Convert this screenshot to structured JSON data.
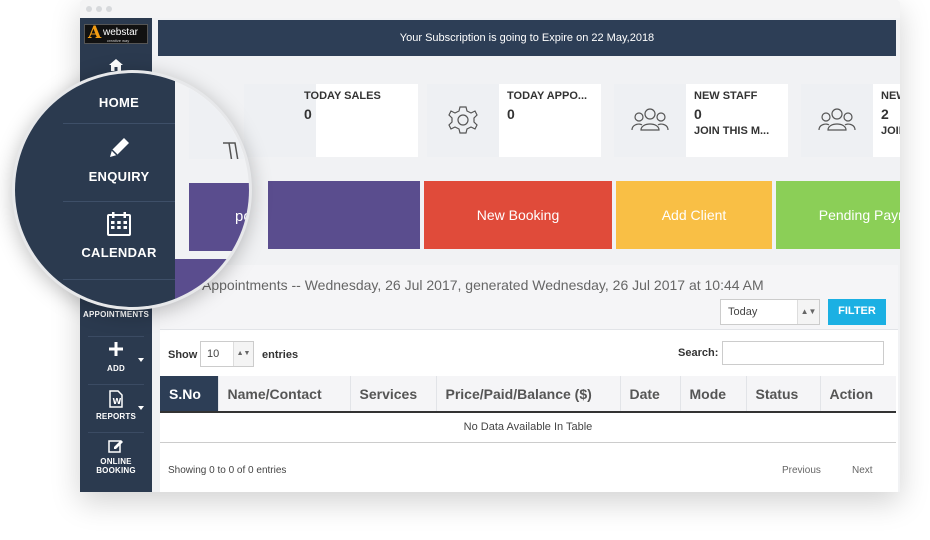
{
  "banner": {
    "text": "Your Subscription is going to Expire on 22 May,2018"
  },
  "logo": {
    "letter": "A",
    "word": "webstar",
    "tag": "creative way"
  },
  "sidebar": {
    "items": [
      {
        "label": "HOME",
        "icon": "home-icon"
      },
      {
        "label": "ENQUIRY",
        "icon": "pencil-icon"
      },
      {
        "label": "CALENDAR",
        "icon": "calendar-icon"
      },
      {
        "label": "APPOINTMENTS",
        "icon": "calculator-icon"
      },
      {
        "label": "ADD",
        "icon": "plus-icon"
      },
      {
        "label": "REPORTS",
        "icon": "document-icon"
      },
      {
        "label": "ONLINE",
        "label2": "BOOKING",
        "icon": "edit-icon"
      }
    ]
  },
  "stats": [
    {
      "title": "TODAY SALES",
      "value": "0",
      "sub": "",
      "icon": "cart-icon"
    },
    {
      "title": "TODAY APPO...",
      "value": "0",
      "sub": "",
      "icon": "gear-icon"
    },
    {
      "title": "NEW STAFF",
      "value": "0",
      "sub": "JOIN THIS M...",
      "icon": "users-icon"
    },
    {
      "title": "NEW CLIENTS",
      "value": "2",
      "sub": "JOIN THIS M...",
      "icon": "users-icon"
    }
  ],
  "tiles": [
    {
      "label": "Reports",
      "color": "#5a4d8e"
    },
    {
      "label": "New Booking",
      "color": "#e04b3a"
    },
    {
      "label": "Add Client",
      "color": "#f9bf45"
    },
    {
      "label": "Pending Payment",
      "color": "#8bcf57"
    }
  ],
  "appointments": {
    "title": "Appointments -- Wednesday, 26 Jul 2017, generated Wednesday, 26 Jul 2017 at 10:44 AM",
    "range_value": "Today",
    "filter_label": "FILTER",
    "show_label": "Show",
    "entries_value": "10",
    "entries_label": "entries",
    "search_label": "Search:",
    "search_value": "",
    "columns": [
      "S.No",
      "Name/Contact",
      "Services",
      "Price/Paid/Balance ($)",
      "Date",
      "Mode",
      "Status",
      "Action"
    ],
    "empty_text": "No Data Available In Table",
    "showing_text": "Showing 0 to 0 of 0 entries",
    "prev_label": "Previous",
    "next_label": "Next"
  },
  "magnifier": {
    "items": [
      "HOME",
      "ENQUIRY",
      "CALENDAR"
    ],
    "partial_tile": "ports"
  }
}
